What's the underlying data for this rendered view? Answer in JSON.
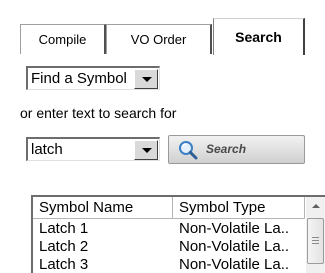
{
  "tabs": [
    {
      "label": "Compile"
    },
    {
      "label": "VO Order"
    },
    {
      "label": "Search",
      "selected": true
    }
  ],
  "find_combo": {
    "value": "Find a Symbol"
  },
  "hint_text": "or enter text to search for",
  "text_combo": {
    "value": "latch"
  },
  "search_button": {
    "label": "Search",
    "icon": "magnifier-icon"
  },
  "results": {
    "columns": [
      "Symbol Name",
      "Symbol Type"
    ],
    "rows": [
      {
        "name": "Latch 1",
        "type": "Non-Volatile La.."
      },
      {
        "name": "Latch 2",
        "type": "Non-Volatile La.."
      },
      {
        "name": "Latch 3",
        "type": "Non-Volatile La.."
      }
    ]
  },
  "colors": {
    "button_text": "#4a4a4a",
    "magnifier_blue": "#3b7fc4"
  }
}
